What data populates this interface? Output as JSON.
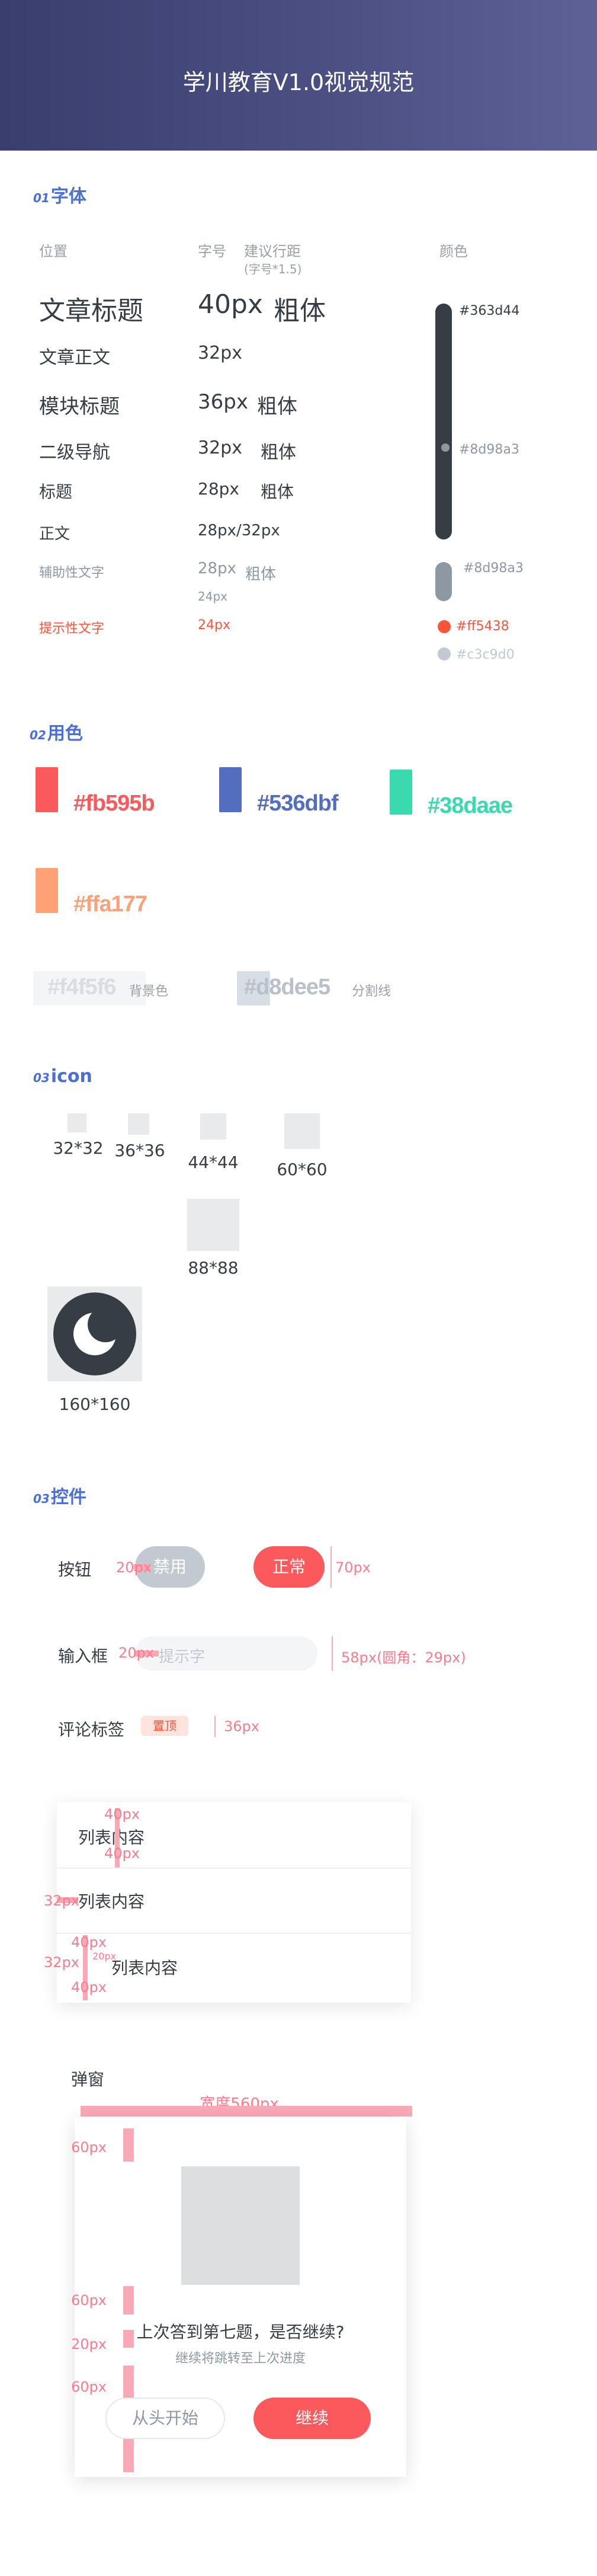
{
  "header": {
    "title": "学川教育V1.0视觉规范"
  },
  "sections": {
    "font": {
      "num": "01",
      "title": "字体"
    },
    "color": {
      "num": "02",
      "title": "用色"
    },
    "icon": {
      "num": "03",
      "title": "icon"
    },
    "control": {
      "num": "03",
      "title": "控件"
    }
  },
  "font_table": {
    "col_position": "位置",
    "col_size": "字号",
    "col_line": "建议行距",
    "col_line_note": "(字号*1.5)",
    "col_color": "颜色",
    "rows": [
      {
        "name": "文章标题",
        "size": "40px",
        "weight": "粗体"
      },
      {
        "name": "文章正文",
        "size": "32px",
        "weight": ""
      },
      {
        "name": "模块标题",
        "size": "36px",
        "weight": "粗体"
      },
      {
        "name": "二级导航",
        "size": "32px",
        "weight": "粗体"
      },
      {
        "name": "标题",
        "size": "28px",
        "weight": "粗体"
      },
      {
        "name": "正文",
        "size": "28px/32px",
        "weight": ""
      },
      {
        "name": "辅助性文字",
        "size": "28px",
        "size2": "24px",
        "weight": "粗体"
      },
      {
        "name": "提示性文字",
        "size": "24px",
        "weight": ""
      }
    ],
    "colors": {
      "c1": "#363d44",
      "c2": "#8d98a3",
      "c3": "#8d98a3",
      "c4": "#ff5438",
      "c5": "#c3c9d0"
    }
  },
  "palette": {
    "c1": "#fb595b",
    "c2": "#536dbf",
    "c3": "#38daae",
    "c4": "#ffa177",
    "c5": "#f4f5f6",
    "c5_label": "背景色",
    "c6": "#d8dee5",
    "c6_label": "分割线"
  },
  "icons": {
    "s32": "32*32",
    "s36": "36*36",
    "s44": "44*44",
    "s60": "60*60",
    "s88": "88*88",
    "s160": "160*160"
  },
  "controls": {
    "button_label": "按钮",
    "disabled": "禁用",
    "normal": "正常",
    "dim_20": "20px",
    "dim_70": "70px",
    "input_label": "输入框",
    "input_placeholder": "提示字",
    "input_dim": "58px(圆角：29px)",
    "tag_label": "评论标签",
    "tag_text": "置顶",
    "tag_dim": "36px",
    "list": {
      "items": [
        "列表内容",
        "列表内容",
        "列表内容"
      ],
      "d40": "40px",
      "d32": "32px",
      "d20": "20px"
    },
    "dialog": {
      "label": "弹窗",
      "width_note": "宽度560px",
      "d60": "60px",
      "d20": "20px",
      "title": "上次答到第七题，是否继续?",
      "sub": "继续将跳转至上次进度",
      "btn_restart": "从头开始",
      "btn_continue": "继续"
    }
  }
}
